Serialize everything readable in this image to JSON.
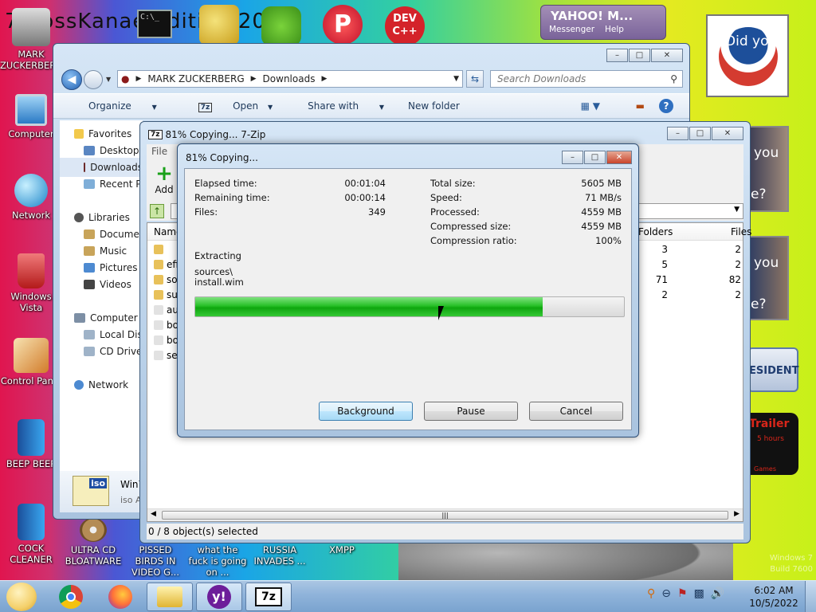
{
  "desktop": {
    "top_banner_text": "7-bossKanae Edition 2012",
    "icons": [
      {
        "label": "MARK ZUCKERBERG"
      },
      {
        "label": "Computer"
      },
      {
        "label": "Network"
      },
      {
        "label": "Windows Vista"
      },
      {
        "label": "Control Panel"
      },
      {
        "label": "BEEP BEEP"
      },
      {
        "label": "COCK CLEANER"
      },
      {
        "label": "ULTRA CD BLOATWARE"
      },
      {
        "label": "PISSED BIRDS IN VIDEO G..."
      },
      {
        "label": "what the fuck is going on ..."
      },
      {
        "label": "RUSSIA INVADES ..."
      },
      {
        "label": "XMPP"
      }
    ],
    "yahoo_widget": {
      "title": "YAHOO! M...",
      "messenger": "Messenger",
      "help": "Help"
    },
    "gadgets": {
      "poster1": "Did you",
      "poster2a": "you",
      "poster2b": "e?",
      "poster3a": "you",
      "poster3b": "e?",
      "president": "ESIDENT",
      "trailer": "Trailer",
      "trailer_sub": "5 hours",
      "trailer_games": "Games"
    },
    "watermark": [
      "Windows 7",
      "Build 7600"
    ]
  },
  "explorer": {
    "path": [
      "MARK ZUCKERBERG",
      "Downloads"
    ],
    "search_placeholder": "Search Downloads",
    "toolbar": {
      "organize": "Organize",
      "open": "Open",
      "share_with": "Share with",
      "new_folder": "New folder"
    },
    "nav": {
      "favorites": "Favorites",
      "favorites_items": [
        "Desktop",
        "Downloads",
        "Recent Places"
      ],
      "libraries": "Libraries",
      "library_items": [
        "Documents",
        "Music",
        "Pictures",
        "Videos"
      ],
      "computer": "Computer",
      "computer_items": [
        "Local Disk",
        "CD Drive"
      ],
      "network": "Network"
    },
    "details": {
      "name": "Win7",
      "type": "iso A"
    }
  },
  "zip_window": {
    "title": "81% Copying... 7-Zip",
    "menu_file": "File",
    "add_label": "Add",
    "columns": {
      "name": "Name",
      "folders": "Folders",
      "files": "Files"
    },
    "rows": [
      {
        "name": "",
        "folders": "3",
        "files": "2"
      },
      {
        "name": "efi",
        "folders": "5",
        "files": "2"
      },
      {
        "name": "sources",
        "folders": "71",
        "files": "82"
      },
      {
        "name": "support",
        "folders": "2",
        "files": "2"
      },
      {
        "name": "autorun",
        "folders": "",
        "files": ""
      },
      {
        "name": "bootmgr",
        "folders": "",
        "files": ""
      },
      {
        "name": "bootmgr.efi",
        "folders": "",
        "files": ""
      },
      {
        "name": "setup",
        "folders": "",
        "files": ""
      }
    ],
    "status": "0 / 8 object(s) selected"
  },
  "progress_dialog": {
    "title": "81% Copying...",
    "left_stats": [
      {
        "label": "Elapsed time:",
        "value": "00:01:04"
      },
      {
        "label": "Remaining time:",
        "value": "00:00:14"
      },
      {
        "label": "Files:",
        "value": "349"
      }
    ],
    "right_stats": [
      {
        "label": "Total size:",
        "value": "5605 MB"
      },
      {
        "label": "Speed:",
        "value": "71 MB/s"
      },
      {
        "label": "Processed:",
        "value": "4559 MB"
      },
      {
        "label": "Compressed size:",
        "value": "4559 MB"
      },
      {
        "label": "Compression ratio:",
        "value": "100%"
      }
    ],
    "operation": "Extracting",
    "current_dir": "sources\\",
    "current_file": "install.wim",
    "progress_fraction": 0.81,
    "buttons": {
      "background": "Background",
      "pause": "Pause",
      "cancel": "Cancel"
    }
  },
  "taskbar": {
    "clock_time": "6:02 AM",
    "clock_date": "10/5/2022"
  }
}
